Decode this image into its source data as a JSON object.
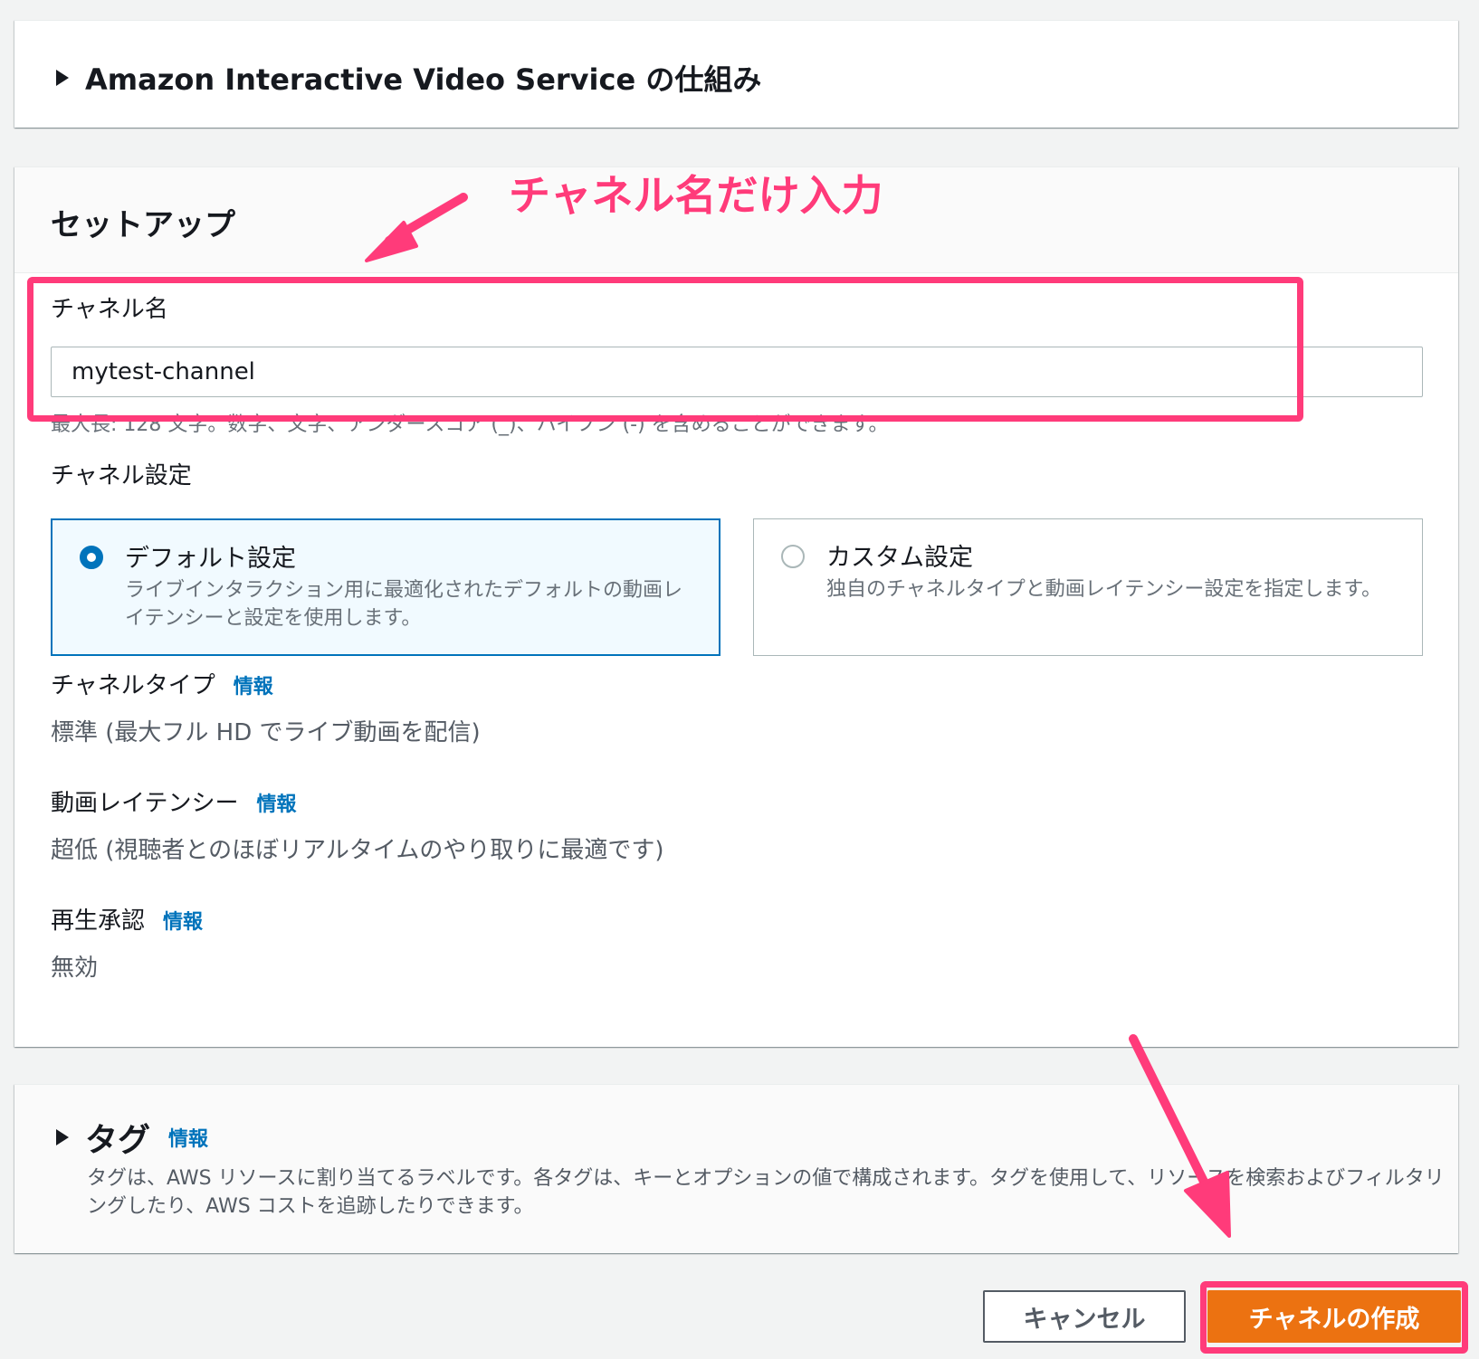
{
  "how_it_works": {
    "title": "Amazon Interactive Video Service の仕組み"
  },
  "setup": {
    "title": "セットアップ",
    "channel_name": {
      "label": "チャネル名",
      "value": "mytest-channel",
      "hint": "最大長: 128 文字。数字、文字、アンダースコア (_)、ハイフン (-) を含めることができます。"
    },
    "channel_settings": {
      "label": "チャネル設定",
      "options": [
        {
          "title": "デフォルト設定",
          "description": "ライブインタラクション用に最適化されたデフォルトの動画レイテンシーと設定を使用します。",
          "selected": true
        },
        {
          "title": "カスタム設定",
          "description": "独自のチャネルタイプと動画レイテンシー設定を指定します。",
          "selected": false
        }
      ]
    },
    "channel_type": {
      "label": "チャネルタイプ",
      "info": "情報",
      "value": "標準 (最大フル HD でライブ動画を配信)"
    },
    "video_latency": {
      "label": "動画レイテンシー",
      "info": "情報",
      "value": "超低 (視聴者とのほぼリアルタイムのやり取りに最適です)"
    },
    "playback_auth": {
      "label": "再生承認",
      "info": "情報",
      "value": "無効"
    }
  },
  "tags": {
    "title": "タグ",
    "info": "情報",
    "description": "タグは、AWS リソースに割り当てるラベルです。各タグは、キーとオプションの値で構成されます。タグを使用して、リソースを検索およびフィルタリングしたり、AWS コストを追跡したりできます。"
  },
  "footer": {
    "cancel_label": "キャンセル",
    "create_label": "チャネルの作成"
  },
  "annotation": {
    "text": "チャネル名だけ入力",
    "color": "#ff3b7a"
  },
  "colors": {
    "primary_button": "#ec7211",
    "link": "#0073bb",
    "selected_tile_border": "#0073bb"
  }
}
